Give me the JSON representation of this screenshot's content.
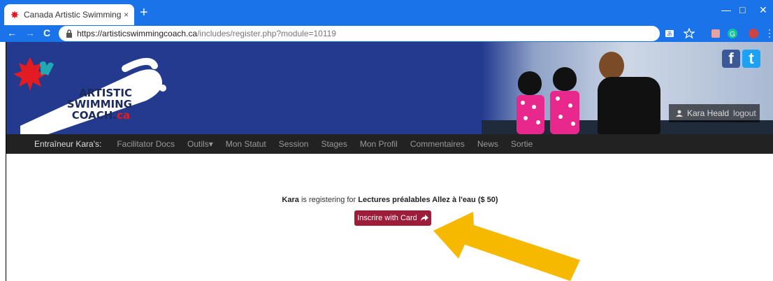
{
  "browser": {
    "tab_title": "Canada Artistic Swimming Entrai",
    "tab_close": "×",
    "new_tab": "+",
    "url_host": "https://artisticswimmingcoach.ca",
    "url_path": "/includes/register.php?module=10119",
    "back": "←",
    "forward": "→",
    "reload": "C",
    "minimize": "—",
    "maximize": "□",
    "close": "✕",
    "menu": "⋮"
  },
  "banner": {
    "logo_line1": "ARTISTIC",
    "logo_line2": "SWIMMING",
    "logo_line3": "COACH.",
    "logo_tld": "ca",
    "user_name": "Kara Heald",
    "logout": "logout",
    "facebook": "f",
    "twitter": "t"
  },
  "nav": {
    "brand": "Entraîneur Kara's:",
    "items": [
      "Facilitator Docs",
      "Outils▾",
      "Mon Statut",
      "Session",
      "Stages",
      "Mon Profil",
      "Commentaires",
      "News",
      "Sortie"
    ]
  },
  "registration": {
    "name": "Kara",
    "text": " is registering for ",
    "course": "Lectures préalables Allez à l'eau",
    "price": " ($ 50)",
    "button": "Inscrire with Card"
  },
  "colors": {
    "chrome": "#1a73e8",
    "banner": "#233a8f",
    "button": "#9d1c39",
    "arrow": "#f7b900"
  }
}
